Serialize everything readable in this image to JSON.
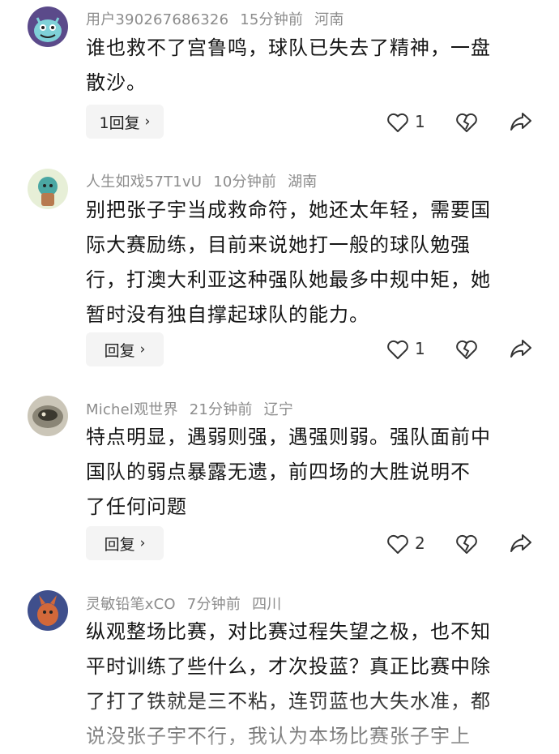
{
  "comments": [
    {
      "username": "用户390267686326",
      "time": "15分钟前",
      "location": "河南",
      "avatar_icon": "monster-avatar-icon",
      "lines": [
        "谁也救不了宫鲁鸣，球队已失去了精神，一盘",
        "散沙。"
      ],
      "reply_label": "1回复",
      "likes": "1"
    },
    {
      "username": "人生如戏57T1vU",
      "time": "10分钟前",
      "location": "湖南",
      "avatar_icon": "cartoon-avatar-icon",
      "lines": [
        "别把张子宇当成救命符，她还太年轻，需要国",
        "际大赛励练，目前来说她打一般的球队勉强",
        "行，打澳大利亚这种强队她最多中规中矩，她",
        "暂时没有独自撑起球队的能力。"
      ],
      "reply_label": "回复",
      "likes": "1"
    },
    {
      "username": "Michel观世界",
      "time": "21分钟前",
      "location": "辽宁",
      "avatar_icon": "photo-avatar-icon",
      "lines": [
        "特点明显，遇弱则强，遇强则弱。强队面前中",
        "国队的弱点暴露无遗，前四场的大胜说明不",
        "了任何问题"
      ],
      "reply_label": "回复",
      "likes": "2"
    },
    {
      "username": "灵敏铅笔xCO",
      "time": "7分钟前",
      "location": "四川",
      "avatar_icon": "animal-avatar-icon",
      "lines": [
        "纵观整场比赛，对比赛过程失望之极，也不知",
        "平时训练了些什么，才次投蓝？真正比赛中除",
        "了打了铁就是三不粘，连罚蓝也大失水准，都",
        "说没张子宇不行，我认为本场比赛张子宇上"
      ]
    }
  ],
  "icons": {
    "like": "heart-outline-icon",
    "dislike": "broken-heart-icon",
    "share": "share-arrow-icon",
    "chevron": "chevron-right-icon"
  },
  "colors": {
    "meta_text": "#8c8c8c",
    "body_text": "#151515",
    "reply_bg": "#f4f4f4"
  }
}
